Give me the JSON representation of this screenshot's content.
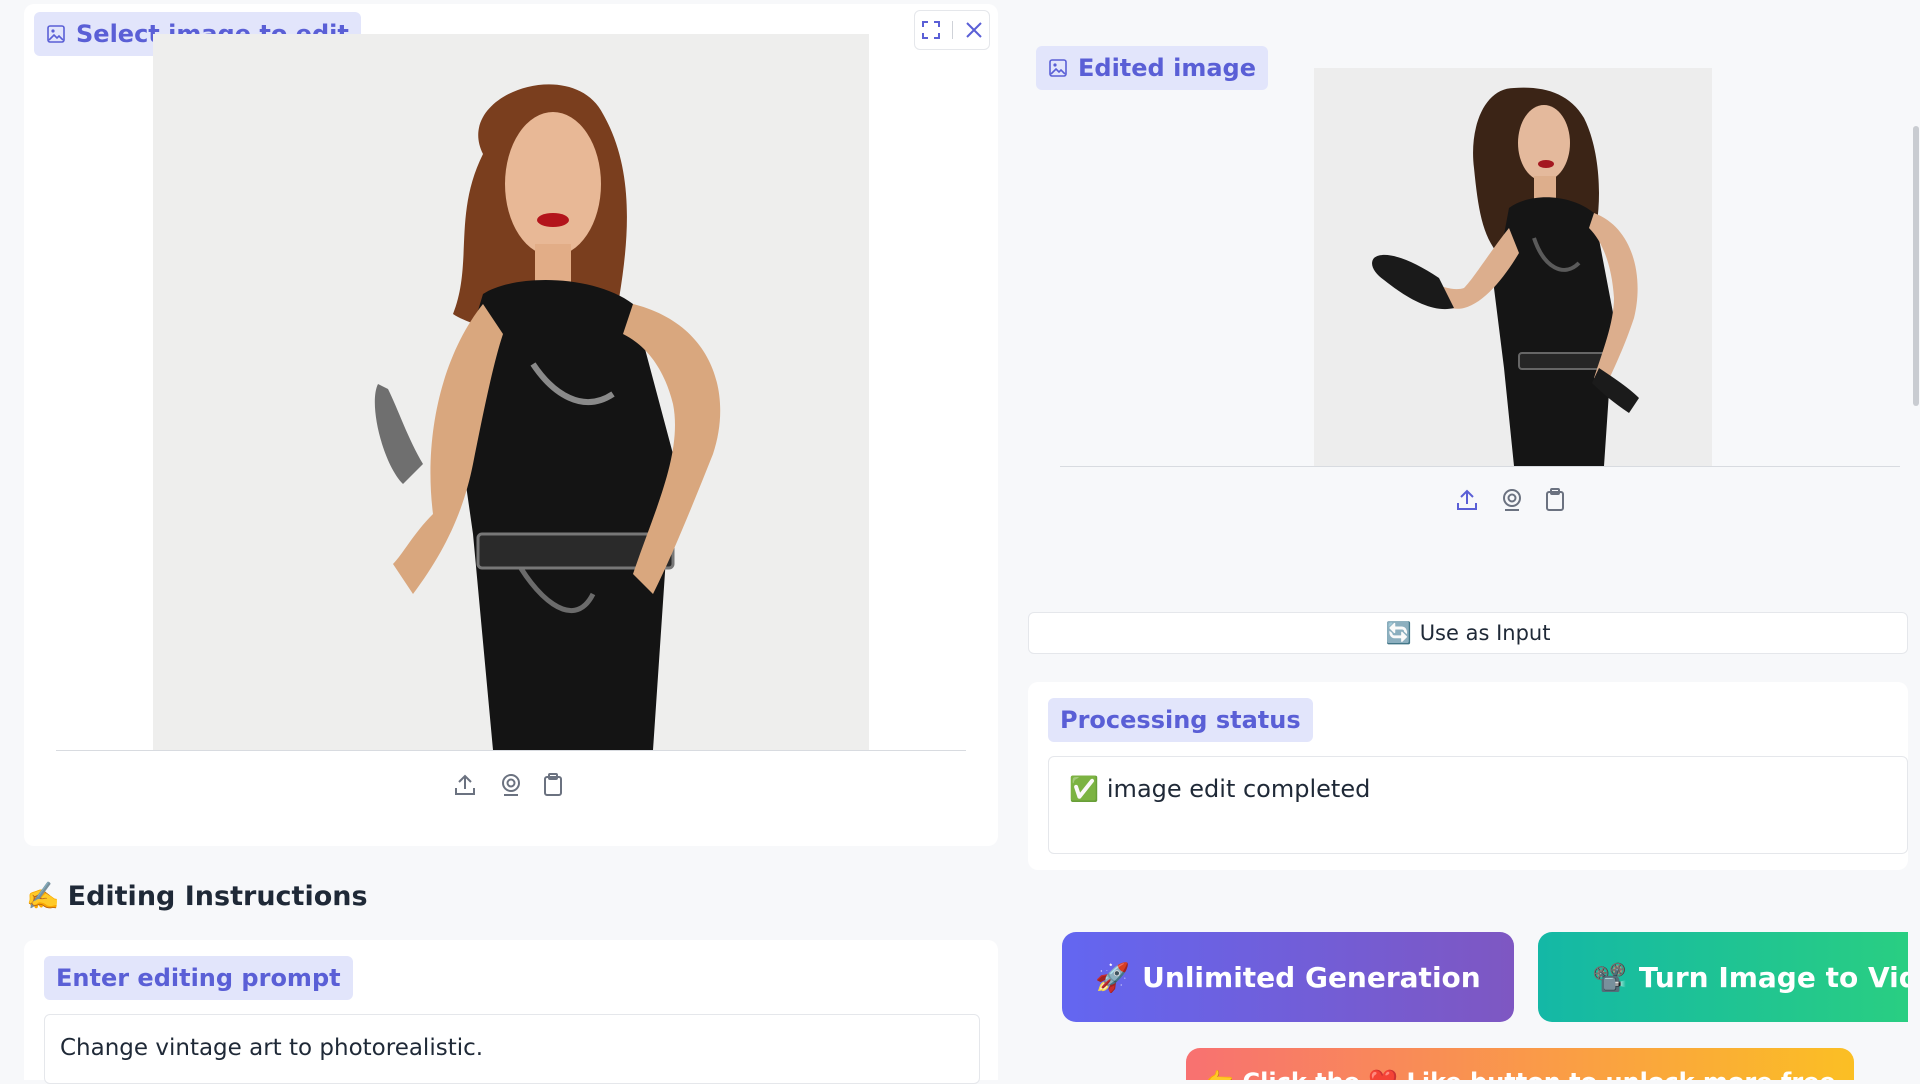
{
  "input_panel": {
    "label": "Select image to edit",
    "image_alt": "Vintage illustration of a woman in a black leather jumpsuit"
  },
  "output_panel": {
    "label": "Edited image",
    "image_alt": "Photorealistic woman in black leather outfit",
    "use_as_input_icon": "🔄",
    "use_as_input_label": "Use as Input"
  },
  "status": {
    "label": "Processing status",
    "icon": "✅",
    "message": "image edit completed"
  },
  "instructions": {
    "heading_icon": "✍️",
    "heading": "Editing Instructions",
    "prompt_label": "Enter editing prompt",
    "prompt_value": "Change vintage art to photorealistic."
  },
  "actions": {
    "unlimited_icon": "🚀",
    "unlimited_label": "Unlimited Generation",
    "video_icon": "📽️",
    "video_label": "Turn Image to Video",
    "like_label": "👉 Click the ❤️ Like button to unlock more free"
  },
  "colors": {
    "accent": "#5a5fd6",
    "chip_bg": "#e2e5fb",
    "unlimited_gradient": [
      "#6366f1",
      "#7e57c2"
    ],
    "video_gradient": [
      "#14b8a6",
      "#2ed37a"
    ],
    "like_gradient": [
      "#f87171",
      "#fbbf24"
    ]
  }
}
